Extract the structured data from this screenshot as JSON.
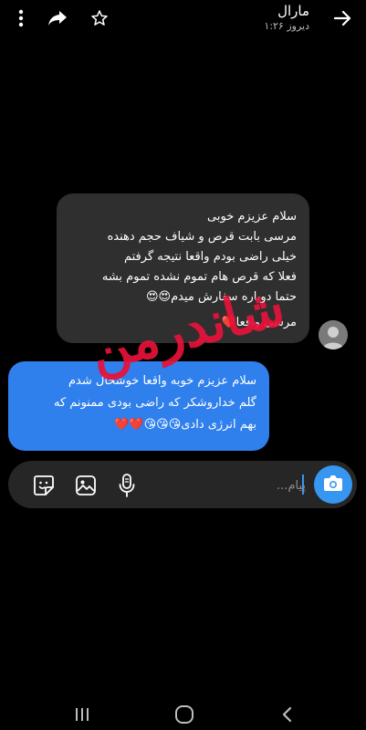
{
  "header": {
    "title": "مارال",
    "subtitle": "دیروز ۱:۲۶",
    "icons": [
      "back-arrow-icon",
      "star-icon",
      "share-icon",
      "more-vertical-icon"
    ]
  },
  "messages": [
    {
      "direction": "incoming",
      "lines": [
        "سلام عزیزم خوبی",
        "مرسی بابت قرص و شیاف حجم دهنده",
        "خیلی راضی بودم واقعا نتیجه گرفتم",
        "فعلا که قرص هام تموم نشده تموم بشه",
        "حتما دوباره سفارش میدم😍😍",
        "مرسی واقعا❤️"
      ]
    },
    {
      "direction": "outgoing",
      "lines": [
        "سلام عزیزم خوبه واقعا خوشحال شدم",
        "گلم خداروشکر که راضی بودی ممنونم که",
        "بهم انرژی دادی😘😘😘❤️❤️"
      ]
    }
  ],
  "watermark": {
    "text": "شاندرمن"
  },
  "composer": {
    "placeholder": "پیام...",
    "icons": [
      "camera-icon",
      "microphone-icon",
      "gallery-icon",
      "sticker-icon"
    ]
  },
  "colors": {
    "background": "#000000",
    "incoming_bubble": "#2f2f2f",
    "outgoing_bubble": "#2f80ed",
    "accent": "#3797f0",
    "watermark": "#e8123a"
  },
  "navigation": {
    "icons": [
      "recents-icon",
      "home-icon",
      "back-icon"
    ]
  }
}
